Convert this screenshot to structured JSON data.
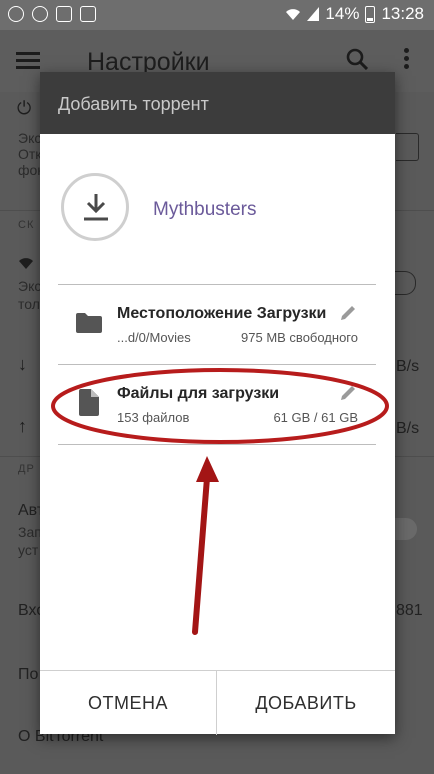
{
  "status_bar": {
    "battery": "14%",
    "time": "13:28"
  },
  "background_screen": {
    "title": "Настройки",
    "fragments": {
      "frag1": "Экс",
      "frag2": "Отк",
      "frag3": "фон",
      "section1": "СК",
      "frag4": "Экс",
      "frag5": "тол",
      "speed1": "B/s",
      "speed2": "B/s",
      "section2": "ДР",
      "auto": "Авт",
      "frag6": "Зап",
      "frag7": "уст",
      "incoming": "Вхо",
      "num": "881",
      "frag8": "По",
      "about": "О BitTorrent"
    }
  },
  "dialog": {
    "title": "Добавить торрент",
    "torrent_name": "Mythbusters",
    "location": {
      "title": "Местоположение Загрузки",
      "path": "...d/0/Movies",
      "free": "975 MB свободного"
    },
    "files": {
      "title": "Файлы для загрузки",
      "count": "153 файлов",
      "size": "61 GB / 61 GB"
    },
    "buttons": {
      "cancel": "ОТМЕНА",
      "add": "ДОБАВИТЬ"
    }
  },
  "colors": {
    "torrent_name": "#6b5a9a",
    "annotation": "#b71c1c",
    "dialog_header": "#3c3c3c"
  }
}
